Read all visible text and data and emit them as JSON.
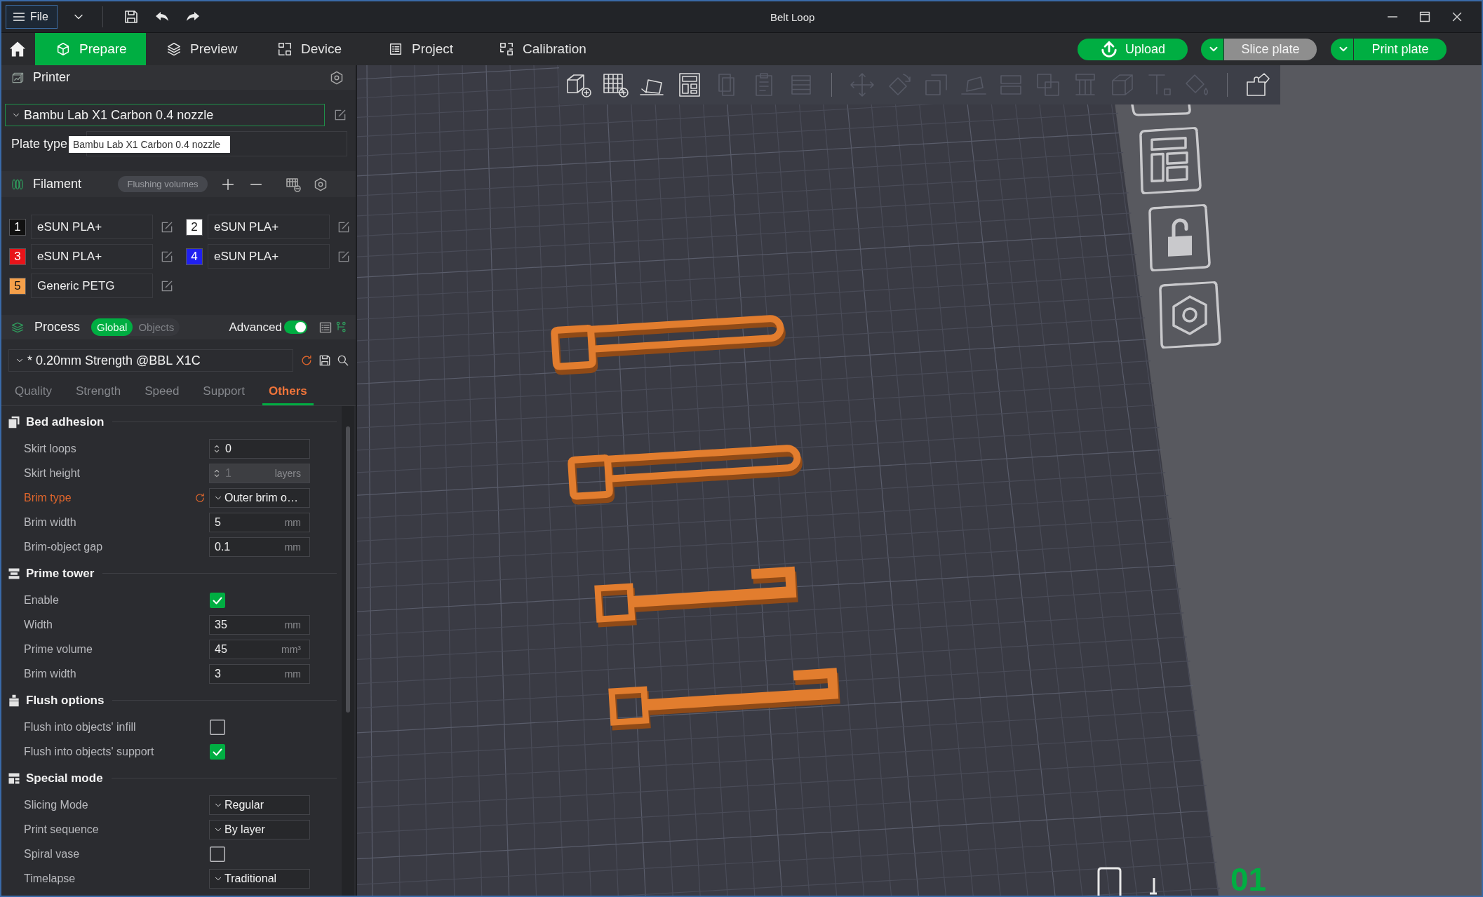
{
  "window": {
    "title": "Belt Loop"
  },
  "menu": {
    "file": "File"
  },
  "tabs": [
    {
      "label": "Prepare",
      "selected": true
    },
    {
      "label": "Preview",
      "selected": false
    },
    {
      "label": "Device",
      "selected": false
    },
    {
      "label": "Project",
      "selected": false
    },
    {
      "label": "Calibration",
      "selected": false
    }
  ],
  "actions": [
    {
      "label": "Upload",
      "kind": "upload",
      "disabled": false
    },
    {
      "label": "Slice plate",
      "kind": "split",
      "disabled": true
    },
    {
      "label": "Print plate",
      "kind": "split",
      "disabled": false
    }
  ],
  "printer": {
    "title": "Printer",
    "preset": "Bambu Lab X1 Carbon 0.4 nozzle",
    "plate_type_label": "Plate type",
    "tooltip": "Bambu Lab X1 Carbon 0.4 nozzle"
  },
  "filament": {
    "title": "Filament",
    "flushing_button": "Flushing volumes",
    "slots": [
      {
        "number": "1",
        "name": "eSUN PLA+",
        "color": "#111111"
      },
      {
        "number": "2",
        "name": "eSUN PLA+",
        "color": "#ffffff"
      },
      {
        "number": "3",
        "name": "eSUN PLA+",
        "color": "#e8141a"
      },
      {
        "number": "4",
        "name": "eSUN PLA+",
        "color": "#2020f0"
      },
      {
        "number": "5",
        "name": "Generic PETG",
        "color": "#f5a04a"
      }
    ]
  },
  "process": {
    "title": "Process",
    "scopes": [
      {
        "label": "Global",
        "selected": true
      },
      {
        "label": "Objects",
        "selected": false
      }
    ],
    "advanced": {
      "label": "Advanced",
      "on": true
    },
    "preset": "* 0.20mm Strength @BBL X1C",
    "modified": true,
    "tabs": [
      {
        "label": "Quality",
        "selected": false
      },
      {
        "label": "Strength",
        "selected": false
      },
      {
        "label": "Speed",
        "selected": false
      },
      {
        "label": "Support",
        "selected": false
      },
      {
        "label": "Others",
        "selected": true
      }
    ],
    "groups": [
      {
        "title": "Bed adhesion",
        "settings": [
          {
            "label": "Skirt loops",
            "kind": "spin",
            "value": "0",
            "disabled": false,
            "modified": false
          },
          {
            "label": "Skirt height",
            "kind": "spin",
            "value": "1",
            "unit": "layers",
            "disabled": true,
            "modified": false
          },
          {
            "label": "Brim type",
            "kind": "select",
            "value": "Outer brim o…",
            "disabled": false,
            "modified": true
          },
          {
            "label": "Brim width",
            "kind": "number",
            "value": "5",
            "unit": "mm",
            "disabled": false,
            "modified": false
          },
          {
            "label": "Brim-object gap",
            "kind": "number",
            "value": "0.1",
            "unit": "mm",
            "disabled": false,
            "modified": false
          }
        ]
      },
      {
        "title": "Prime tower",
        "settings": [
          {
            "label": "Enable",
            "kind": "check",
            "checked": true,
            "disabled": false,
            "modified": false
          },
          {
            "label": "Width",
            "kind": "number",
            "value": "35",
            "unit": "mm",
            "disabled": false,
            "modified": false
          },
          {
            "label": "Prime volume",
            "kind": "number",
            "value": "45",
            "unit": "mm³",
            "disabled": false,
            "modified": false
          },
          {
            "label": "Brim width",
            "kind": "number",
            "value": "3",
            "unit": "mm",
            "disabled": false,
            "modified": false
          }
        ]
      },
      {
        "title": "Flush options",
        "settings": [
          {
            "label": "Flush into objects' infill",
            "kind": "check",
            "checked": false,
            "disabled": false,
            "modified": false
          },
          {
            "label": "Flush into objects' support",
            "kind": "check",
            "checked": true,
            "disabled": false,
            "modified": false
          }
        ]
      },
      {
        "title": "Special mode",
        "settings": [
          {
            "label": "Slicing Mode",
            "kind": "select",
            "value": "Regular",
            "disabled": false,
            "modified": false
          },
          {
            "label": "Print sequence",
            "kind": "select",
            "value": "By layer",
            "disabled": false,
            "modified": false
          },
          {
            "label": "Spiral vase",
            "kind": "check",
            "checked": false,
            "disabled": false,
            "modified": false
          },
          {
            "label": "Timelapse",
            "kind": "select",
            "value": "Traditional",
            "disabled": false,
            "modified": false
          }
        ]
      }
    ]
  },
  "viewport": {
    "toolbar": [
      {
        "tools": [
          {
            "kind": "add",
            "disabled": false
          },
          {
            "kind": "plate",
            "disabled": false
          },
          {
            "kind": "orient",
            "disabled": false
          },
          {
            "kind": "arrange",
            "disabled": false
          },
          {
            "kind": "copy",
            "disabled": true
          },
          {
            "kind": "paste",
            "disabled": true
          },
          {
            "kind": "layers",
            "disabled": true
          }
        ]
      },
      {
        "tools": [
          {
            "kind": "move",
            "disabled": true
          },
          {
            "kind": "rotate",
            "disabled": true
          },
          {
            "kind": "scale",
            "disabled": true
          },
          {
            "kind": "face",
            "disabled": true
          },
          {
            "kind": "cut",
            "disabled": true
          },
          {
            "kind": "boolean",
            "disabled": true
          },
          {
            "kind": "support",
            "disabled": true
          },
          {
            "kind": "measure",
            "disabled": true
          },
          {
            "kind": "text",
            "disabled": true
          },
          {
            "kind": "paint",
            "disabled": true
          }
        ]
      },
      {
        "tools": [
          {
            "kind": "assembly",
            "disabled": false
          }
        ]
      }
    ],
    "plate_number": "01"
  }
}
